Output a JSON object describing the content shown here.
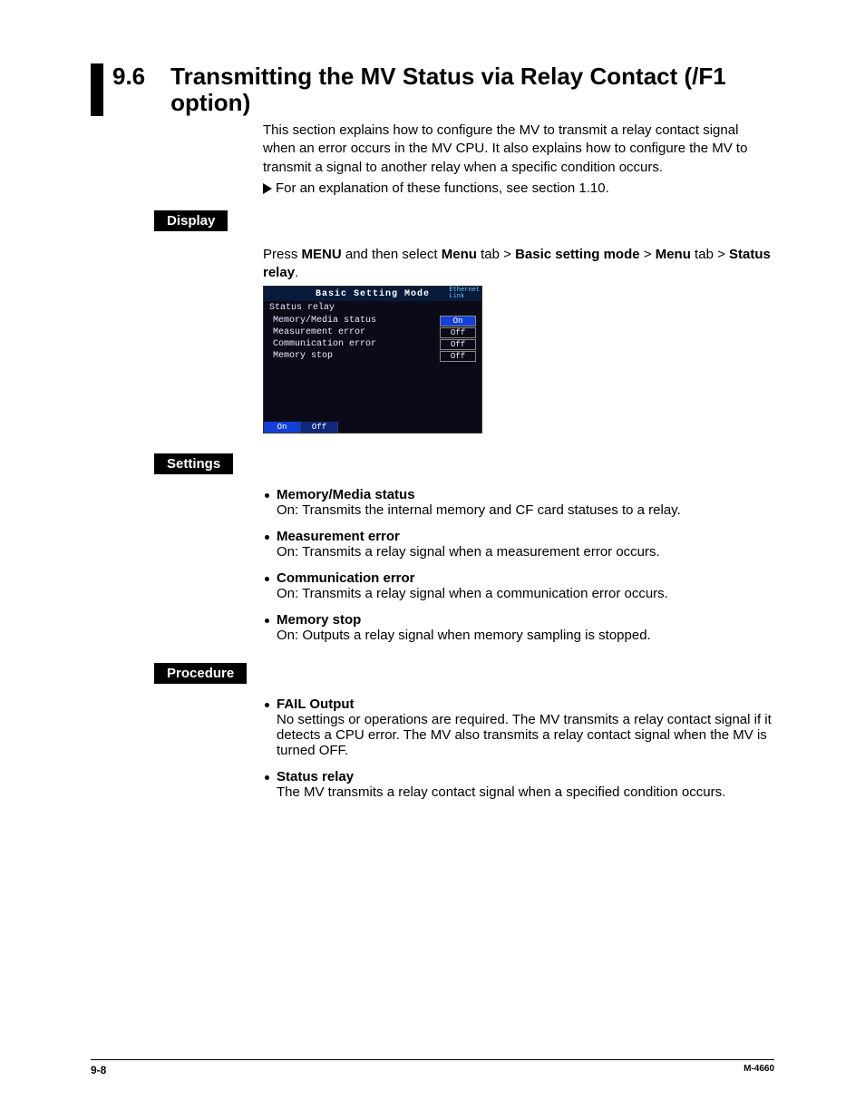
{
  "heading": {
    "number": "9.6",
    "title": "Transmitting the MV Status via Relay Contact (/F1 option)"
  },
  "intro": "This section explains how to configure the MV to transmit a relay contact signal when an error occurs in the MV CPU. It also explains how to configure the MV to transmit a signal to another relay when a specific condition occurs.",
  "xref": "For an explanation of these functions, see section 1.10.",
  "display": {
    "label": "Display",
    "instr_prefix": "Press ",
    "instr_menu": "MENU",
    "instr_mid1": " and then select ",
    "instr_b1": "Menu",
    "instr_s1": " tab > ",
    "instr_b2": "Basic setting mode",
    "instr_s2": " > ",
    "instr_b3": "Menu",
    "instr_s3": " tab > ",
    "instr_b4": "Status relay",
    "instr_suffix": "."
  },
  "device": {
    "title": "Basic Setting Mode",
    "eth1": "Ethernet",
    "eth2": "Link",
    "subhead": "Status relay",
    "rows": [
      {
        "label": "Memory/Media status",
        "value": "On",
        "on": true
      },
      {
        "label": "Measurement error",
        "value": "Off",
        "on": false
      },
      {
        "label": "Communication error",
        "value": "Off",
        "on": false
      },
      {
        "label": "Memory stop",
        "value": "Off",
        "on": false
      }
    ],
    "btn_on": "On",
    "btn_off": "Off"
  },
  "settings": {
    "label": "Settings",
    "items": [
      {
        "head": "Memory/Media status",
        "desc": "On: Transmits the internal memory and CF card statuses to a relay."
      },
      {
        "head": "Measurement error",
        "desc": "On: Transmits a relay signal when a measurement error occurs."
      },
      {
        "head": "Communication error",
        "desc": "On: Transmits a relay signal when a communication error occurs."
      },
      {
        "head": "Memory stop",
        "desc": "On: Outputs a relay signal when memory sampling is stopped."
      }
    ]
  },
  "procedure": {
    "label": "Procedure",
    "items": [
      {
        "head": "FAIL Output",
        "desc": "No settings or operations are required. The MV transmits a relay contact signal if it detects a CPU error. The MV also transmits a relay contact signal when the MV is turned OFF."
      },
      {
        "head": "Status relay",
        "desc": "The MV transmits a relay contact signal when a specified condition occurs."
      }
    ]
  },
  "footer": {
    "page": "9-8",
    "docid": "M-4660"
  }
}
